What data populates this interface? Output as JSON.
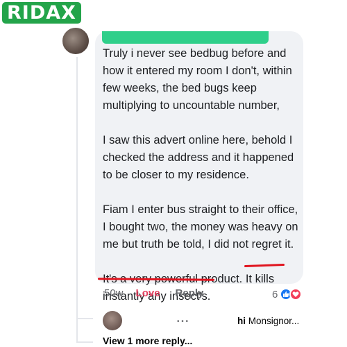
{
  "brand": {
    "name": "RIDAX",
    "color": "#23a44a"
  },
  "comment": {
    "paragraphs": [
      "Truly i never see bedbug before and how it entered my room I don't, within few weeks, the bed bugs keep multiplying to uncountable number,",
      "I saw this advert online here, behold I checked the address and it happened to be closer to my residence.",
      "Fiam I enter bus straight to their office, I bought two, the money was heavy on me but truth be told, I did not regret it.",
      "It's a very powerful product. It kills instantly any insect's."
    ],
    "time": "50w",
    "love_label": "Love",
    "reply_label": "Reply",
    "reaction_count": "6",
    "reaction_icons": [
      "like-icon",
      "heart-icon"
    ]
  },
  "nested_reply": {
    "preview_bold": "hi",
    "preview_text": "Monsignor..."
  },
  "view_more": "View 1 more reply...",
  "colors": {
    "love": "#e4405f",
    "like": "#1877f2",
    "heart": "#f33e58",
    "annotation": "#e0141e",
    "bubble": "#f0f2f5"
  }
}
